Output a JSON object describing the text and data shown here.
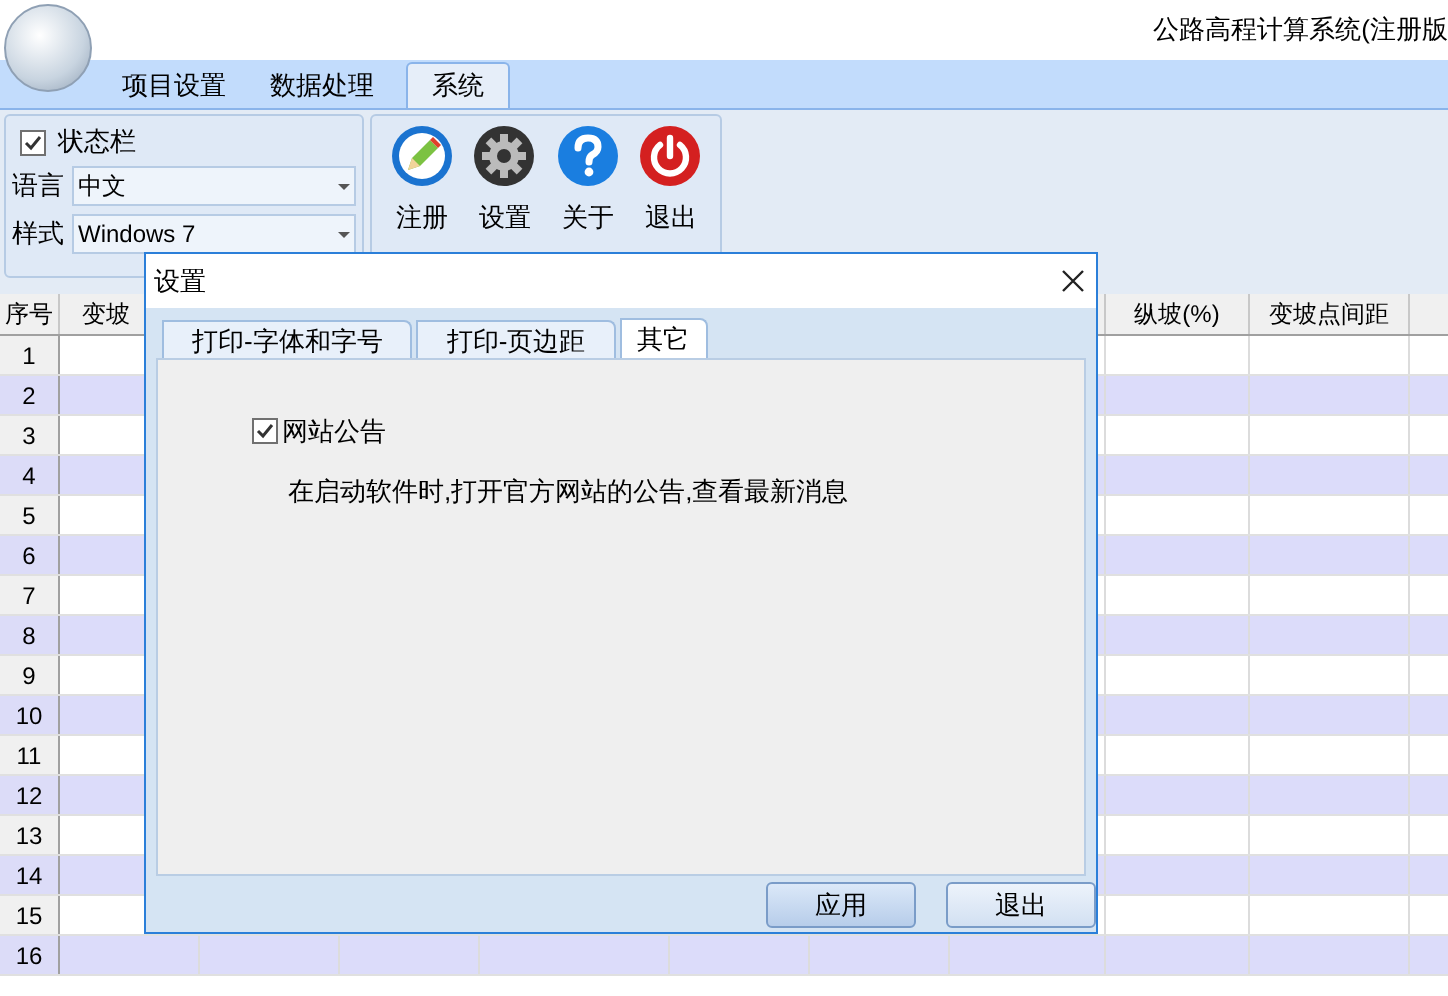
{
  "window": {
    "title": "公路高程计算系统(注册版"
  },
  "ribbon_tabs": [
    {
      "label": "项目设置",
      "selected": false
    },
    {
      "label": "数据处理",
      "selected": false
    },
    {
      "label": "系统",
      "selected": true
    }
  ],
  "ribbon": {
    "status_bar": {
      "label": "状态栏",
      "checked": true
    },
    "fields": [
      {
        "label": "语言",
        "value": "中文"
      },
      {
        "label": "样式",
        "value": "Windows 7"
      }
    ],
    "buttons": [
      {
        "label": "注册",
        "kind": "register"
      },
      {
        "label": "设置",
        "kind": "settings"
      },
      {
        "label": "关于",
        "kind": "about"
      },
      {
        "label": "退出",
        "kind": "exit"
      }
    ]
  },
  "grid": {
    "columns_left": [
      "序号",
      "变坡"
    ],
    "columns_right": [
      "纵坡(%)",
      "变坡点间距"
    ],
    "row_numbers": [
      "1",
      "2",
      "3",
      "4",
      "5",
      "6",
      "7",
      "8",
      "9",
      "10",
      "11",
      "12",
      "13",
      "14",
      "15",
      "16"
    ]
  },
  "dialog": {
    "title": "设置",
    "tabs": [
      {
        "label": "打印-字体和字号",
        "selected": false
      },
      {
        "label": "打印-页边距",
        "selected": false
      },
      {
        "label": "其它",
        "selected": true
      }
    ],
    "option": {
      "label": "网站公告",
      "checked": true
    },
    "description": "在启动软件时,打开官方网站的公告,查看最新消息",
    "buttons": [
      "应用",
      "退出"
    ]
  }
}
